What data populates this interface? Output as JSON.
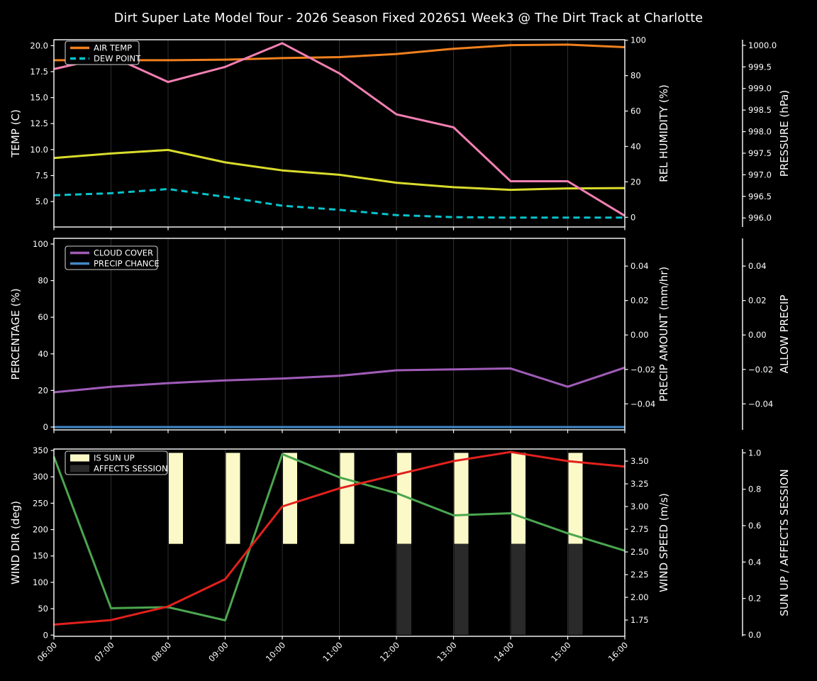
{
  "title": "Dirt Super Late Model Tour - 2026 Season Fixed 2026S1 Week3 @ The Dirt Track at Charlotte",
  "style": {
    "background": "#000000",
    "text_color": "#ffffff",
    "grid_color": "#2d2d2d",
    "spine_color": "#ffffff",
    "legend_border_color": "#cccccc",
    "legend_fill": "#000000"
  },
  "x_axis": {
    "hours": [
      6,
      7,
      8,
      9,
      10,
      11,
      12,
      13,
      14,
      15,
      16
    ],
    "labels": [
      "06:00",
      "07:00",
      "08:00",
      "09:00",
      "10:00",
      "11:00",
      "12:00",
      "13:00",
      "14:00",
      "15:00",
      "16:00"
    ]
  },
  "chart_data": [
    {
      "name": "temperature-panel",
      "type": "line",
      "x": [
        6,
        7,
        8,
        9,
        10,
        11,
        12,
        13,
        14,
        15,
        16
      ],
      "grid": true,
      "legend_position": "upper-left",
      "axes": {
        "left": {
          "label": "TEMP (C)",
          "label_color": "#ffffff",
          "ticks": [
            5,
            7.5,
            10,
            12.5,
            15,
            17.5,
            20
          ],
          "tick_labels": [
            "5.0",
            "7.5",
            "10.0",
            "12.5",
            "15.0",
            "17.5",
            "20.0"
          ],
          "range": [
            2.55,
            20.57
          ]
        },
        "right0": {
          "label": "REL HUMIDITY (%)",
          "label_color": "#d9dc2c",
          "ticks": [
            0,
            20,
            40,
            60,
            80,
            100
          ],
          "tick_labels": [
            "0",
            "20",
            "40",
            "60",
            "80",
            "100"
          ],
          "range": [
            -5.49,
            100.28
          ]
        },
        "right1": {
          "label": "PRESSURE (hPa)",
          "label_color": "#f27fb2",
          "ticks": [
            996,
            996.5,
            997,
            997.5,
            998,
            998.5,
            999,
            999.5,
            1000
          ],
          "tick_labels": [
            "996.0",
            "996.5",
            "997.0",
            "997.5",
            "998.0",
            "998.5",
            "999.0",
            "999.5",
            "1000.0"
          ],
          "range": [
            995.79,
            1000.13
          ]
        }
      },
      "series": [
        {
          "id": "air-temp",
          "name": "AIR TEMP",
          "type": "line",
          "axis": "left",
          "color": "#f0801e",
          "style": "solid",
          "in_legend": true,
          "values": [
            18.6,
            18.6,
            18.6,
            18.65,
            18.8,
            18.9,
            19.2,
            19.7,
            20.05,
            20.1,
            19.85
          ]
        },
        {
          "id": "dew-point",
          "name": "DEW POINT",
          "type": "line",
          "axis": "left",
          "color": "#06c3cc",
          "style": "dashed",
          "in_legend": true,
          "values": [
            5.6,
            5.8,
            6.2,
            5.45,
            4.6,
            4.2,
            3.7,
            3.5,
            3.45,
            3.45,
            3.45
          ]
        },
        {
          "id": "rel-humidity",
          "name": "REL HUMIDITY",
          "type": "line",
          "axis": "right0",
          "color": "#d9dc2c",
          "style": "solid",
          "in_legend": false,
          "values": [
            33.5,
            36,
            38,
            31,
            26.5,
            24,
            19.5,
            17,
            15.5,
            16.3,
            16.5
          ]
        },
        {
          "id": "pressure",
          "name": "PRESSURE",
          "type": "line",
          "axis": "right1",
          "color": "#f27fb2",
          "style": "solid",
          "in_legend": false,
          "values": [
            999.45,
            999.75,
            999.15,
            999.5,
            1000.05,
            999.35,
            998.4,
            998.1,
            996.85,
            996.85,
            996.05
          ]
        }
      ]
    },
    {
      "name": "precipitation-panel",
      "type": "line",
      "x": [
        6,
        7,
        8,
        9,
        10,
        11,
        12,
        13,
        14,
        15,
        16
      ],
      "grid": true,
      "legend_position": "upper-left",
      "axes": {
        "left": {
          "label": "PERCENTAGE (%)",
          "label_color": "#ffffff",
          "ticks": [
            0,
            20,
            40,
            60,
            80,
            100
          ],
          "tick_labels": [
            "0",
            "20",
            "40",
            "60",
            "80",
            "100"
          ],
          "range": [
            -1.55,
            103.1
          ]
        },
        "right0": {
          "label": "PRECIP AMOUNT (mm/hr)",
          "label_color": "#c5622d",
          "ticks": [
            -0.04,
            -0.02,
            0,
            0.02,
            0.04
          ],
          "tick_labels": [
            "−0.04",
            "−0.02",
            "0.00",
            "0.02",
            "0.04"
          ],
          "range": [
            -0.0551,
            0.0561
          ]
        },
        "right1": {
          "label": "ALLOW PRECIP",
          "label_color": "#ffffff",
          "ticks": [
            -0.04,
            -0.02,
            0,
            0.02,
            0.04
          ],
          "tick_labels": [
            "−0.04",
            "−0.02",
            "0.00",
            "0.02",
            "0.04"
          ],
          "range": [
            -0.0551,
            0.0561
          ]
        }
      },
      "series": [
        {
          "id": "cloud-cover",
          "name": "CLOUD COVER",
          "type": "line",
          "axis": "left",
          "color": "#a05cb8",
          "style": "solid",
          "in_legend": true,
          "values": [
            19,
            22,
            24,
            25.5,
            26.5,
            28,
            31,
            31.5,
            32,
            22,
            32.5
          ]
        },
        {
          "id": "precip-chance",
          "name": "PRECIP CHANCE",
          "type": "line",
          "axis": "left",
          "color": "#4289c7",
          "style": "solid",
          "in_legend": true,
          "values": [
            0,
            0,
            0,
            0,
            0,
            0,
            0,
            0,
            0,
            0,
            0
          ]
        }
      ]
    },
    {
      "name": "wind-panel",
      "type": "line",
      "x": [
        6,
        7,
        8,
        9,
        10,
        11,
        12,
        13,
        14,
        15,
        16
      ],
      "grid": true,
      "legend_position": "upper-left",
      "show_x_labels": true,
      "axes": {
        "left": {
          "label": "WIND DIR (deg)",
          "label_color": "#4ba64f",
          "ticks": [
            0,
            50,
            100,
            150,
            200,
            250,
            300,
            350
          ],
          "tick_labels": [
            "0",
            "50",
            "100",
            "150",
            "200",
            "250",
            "300",
            "350"
          ],
          "range": [
            -2.3,
            352.7
          ]
        },
        "right0": {
          "label": "WIND SPEED (m/s)",
          "label_color": "#e2211c",
          "ticks": [
            1.75,
            2,
            2.25,
            2.5,
            2.75,
            3,
            3.25,
            3.5
          ],
          "tick_labels": [
            "1.75",
            "2.00",
            "2.25",
            "2.50",
            "2.75",
            "3.00",
            "3.25",
            "3.50"
          ],
          "range": [
            1.571,
            3.633
          ]
        },
        "right1": {
          "label": "SUN UP / AFFECTS SESSION",
          "label_color": "#ffffff",
          "ticks": [
            0,
            0.2,
            0.4,
            0.6,
            0.8,
            1.0
          ],
          "tick_labels": [
            "0.0",
            "0.2",
            "0.4",
            "0.6",
            "0.8",
            "1.0"
          ],
          "range": [
            -0.008,
            1.021
          ]
        }
      },
      "series": [
        {
          "id": "is-sun-up",
          "name": "IS SUN UP",
          "type": "bar",
          "axis": "right1",
          "color": "#fbf9c7",
          "in_legend": true,
          "bar_span": [
            0.5,
            1.0
          ],
          "values": [
            0,
            0,
            1,
            1,
            1,
            1,
            1,
            1,
            1,
            1,
            0
          ]
        },
        {
          "id": "affects-session",
          "name": "AFFECTS SESSION",
          "type": "bar",
          "axis": "right1",
          "color": "#2a2a2a",
          "in_legend": true,
          "bar_span": [
            0.0,
            0.5
          ],
          "values": [
            0,
            0,
            0,
            0,
            0,
            0,
            1,
            1,
            1,
            1,
            0
          ]
        },
        {
          "id": "wind-dir",
          "name": "WIND DIR",
          "type": "line",
          "axis": "left",
          "color": "#4ba64f",
          "style": "solid",
          "in_legend": false,
          "values": [
            338,
            51,
            53,
            28,
            343,
            299,
            269,
            227,
            231,
            193,
            160
          ]
        },
        {
          "id": "wind-speed",
          "name": "WIND SPEED",
          "type": "line",
          "axis": "right0",
          "color": "#e2211c",
          "style": "solid",
          "in_legend": false,
          "values": [
            1.7,
            1.75,
            1.9,
            2.2,
            3.0,
            3.2,
            3.35,
            3.5,
            3.6,
            3.5,
            3.44
          ]
        }
      ]
    }
  ]
}
